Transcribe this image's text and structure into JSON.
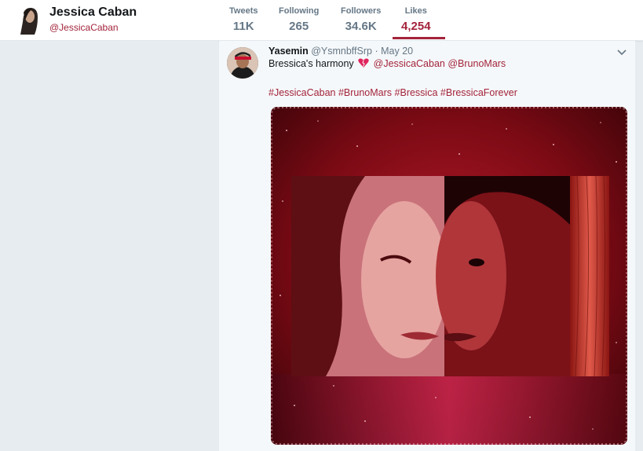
{
  "profile": {
    "name": "Jessica Caban",
    "handle": "@JessicaCaban"
  },
  "stats": [
    {
      "label": "Tweets",
      "value": "11K",
      "active": false
    },
    {
      "label": "Following",
      "value": "265",
      "active": false
    },
    {
      "label": "Followers",
      "value": "34.6K",
      "active": false
    },
    {
      "label": "Likes",
      "value": "4,254",
      "active": true
    }
  ],
  "tweet": {
    "name": "Yasemin",
    "handle": "@YsmnbffSrp",
    "separator": "·",
    "time": "May 20",
    "text_before": "Bressica's harmony",
    "mention_1": "@JessicaCaban",
    "mention_2": "@BrunoMars",
    "hashtags": [
      "#JessicaCaban",
      "#BrunoMars",
      "#Bressica",
      "#BressicaForever"
    ],
    "emoji_icon": "broken-heart-icon",
    "menu_icon": "chevron-down-icon"
  },
  "colors": {
    "accent": "#a3243b",
    "background": "#e6ecf0",
    "card": "#f5f8fa",
    "muted": "#657786"
  }
}
